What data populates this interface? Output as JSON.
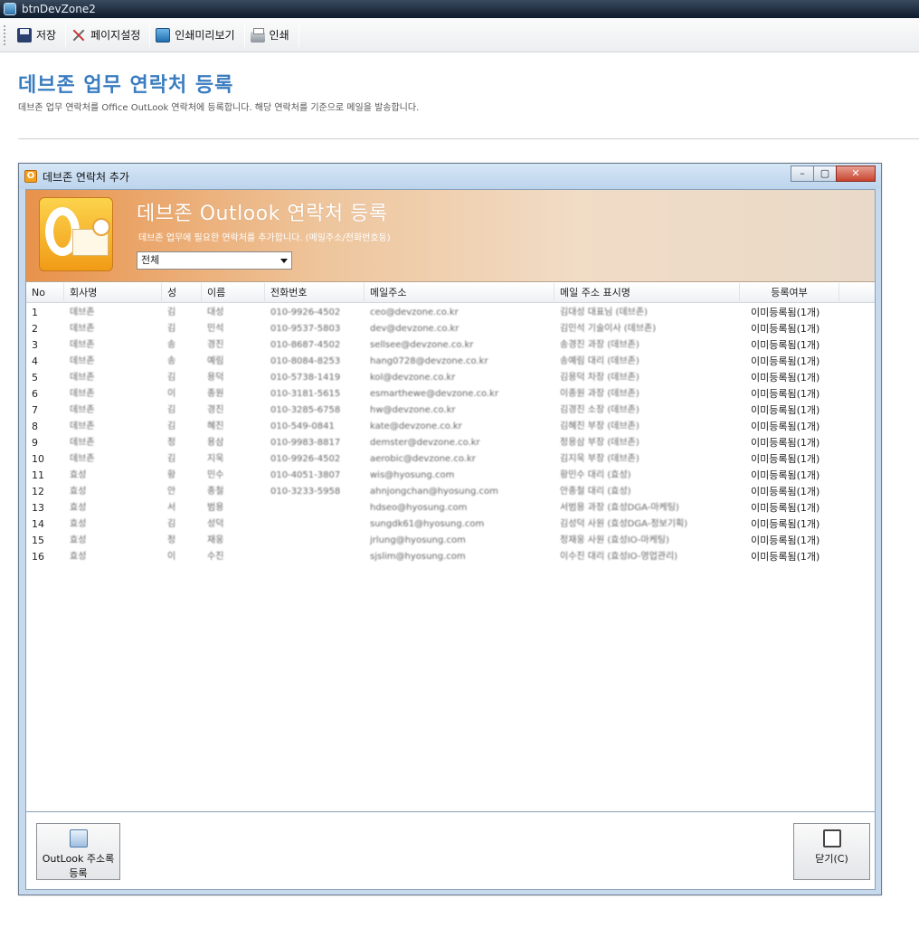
{
  "window": {
    "title": "btnDevZone2"
  },
  "toolbar": {
    "save": "저장",
    "page_setup": "페이지설정",
    "print_preview": "인쇄미리보기",
    "print": "인쇄"
  },
  "page": {
    "title": "데브존 업무 연락처 등록",
    "description": "데브존 업무 연락처를 Office OutLook 연락처에 등록합니다. 해당 연락처를 기준으로 메일을 발송합니다."
  },
  "dialog": {
    "title": "데브존 연락처 추가",
    "controls": {
      "minimize": "–",
      "maximize": "▢",
      "close": "✕"
    },
    "banner_title": "데브존 Outlook 연락처 등록",
    "banner_sub": "데브존 업무에 필요한 연락처를 추가합니다. (메일주소/전화번호등)",
    "filter_value": "전체",
    "columns": [
      "No",
      "회사명",
      "성",
      "이름",
      "전화번호",
      "메일주소",
      "메일 주소 표시명",
      "등록여부"
    ],
    "rows": [
      {
        "no": "1",
        "company": "데브존",
        "last": "김",
        "first": "대성",
        "phone": "010-9926-4502",
        "email": "ceo@devzone.co.kr",
        "display": "김대성 대표님 (데브존)",
        "status": "이미등록됨(1개)"
      },
      {
        "no": "2",
        "company": "데브존",
        "last": "김",
        "first": "민석",
        "phone": "010-9537-5803",
        "email": "dev@devzone.co.kr",
        "display": "김민석 기술이사 (데브존)",
        "status": "이미등록됨(1개)"
      },
      {
        "no": "3",
        "company": "데브존",
        "last": "송",
        "first": "경진",
        "phone": "010-8687-4502",
        "email": "sellsee@devzone.co.kr",
        "display": "송경진 과장 (데브존)",
        "status": "이미등록됨(1개)"
      },
      {
        "no": "4",
        "company": "데브존",
        "last": "송",
        "first": "예림",
        "phone": "010-8084-8253",
        "email": "hang0728@devzone.co.kr",
        "display": "송예림 대리 (데브존)",
        "status": "이미등록됨(1개)"
      },
      {
        "no": "5",
        "company": "데브존",
        "last": "김",
        "first": "용덕",
        "phone": "010-5738-1419",
        "email": "kol@devzone.co.kr",
        "display": "김용덕 차장 (데브존)",
        "status": "이미등록됨(1개)"
      },
      {
        "no": "6",
        "company": "데브존",
        "last": "이",
        "first": "종원",
        "phone": "010-3181-5615",
        "email": "esmarthewe@devzone.co.kr",
        "display": "이종원 과장 (데브존)",
        "status": "이미등록됨(1개)"
      },
      {
        "no": "7",
        "company": "데브존",
        "last": "김",
        "first": "경진",
        "phone": "010-3285-6758",
        "email": "hw@devzone.co.kr",
        "display": "김경진 소장 (데브존)",
        "status": "이미등록됨(1개)"
      },
      {
        "no": "8",
        "company": "데브존",
        "last": "김",
        "first": "혜진",
        "phone": "010-549-0841",
        "email": "kate@devzone.co.kr",
        "display": "김혜진 부장 (데브존)",
        "status": "이미등록됨(1개)"
      },
      {
        "no": "9",
        "company": "데브존",
        "last": "정",
        "first": "용삼",
        "phone": "010-9983-8817",
        "email": "demster@devzone.co.kr",
        "display": "정용삼 부장 (데브존)",
        "status": "이미등록됨(1개)"
      },
      {
        "no": "10",
        "company": "데브존",
        "last": "김",
        "first": "지욱",
        "phone": "010-9926-4502",
        "email": "aerobic@devzone.co.kr",
        "display": "김지욱 부장 (데브존)",
        "status": "이미등록됨(1개)"
      },
      {
        "no": "11",
        "company": "효성",
        "last": "황",
        "first": "민수",
        "phone": "010-4051-3807",
        "email": "wis@hyosung.com",
        "display": "황민수 대리 (효성)",
        "status": "이미등록됨(1개)"
      },
      {
        "no": "12",
        "company": "효성",
        "last": "안",
        "first": "종철",
        "phone": "010-3233-5958",
        "email": "ahnjongchan@hyosung.com",
        "display": "안종철 대리 (효성)",
        "status": "이미등록됨(1개)"
      },
      {
        "no": "13",
        "company": "효성",
        "last": "서",
        "first": "범용",
        "phone": "",
        "email": "hdseo@hyosung.com",
        "display": "서범용 과장 (효성DGA-마케팅)",
        "status": "이미등록됨(1개)"
      },
      {
        "no": "14",
        "company": "효성",
        "last": "김",
        "first": "성덕",
        "phone": "",
        "email": "sungdk61@hyosung.com",
        "display": "김성덕 사원 (효성DGA-정보기획)",
        "status": "이미등록됨(1개)"
      },
      {
        "no": "15",
        "company": "효성",
        "last": "정",
        "first": "재웅",
        "phone": "",
        "email": "jrlung@hyosung.com",
        "display": "정재웅 사원 (효성IO-마케팅)",
        "status": "이미등록됨(1개)"
      },
      {
        "no": "16",
        "company": "효성",
        "last": "이",
        "first": "수진",
        "phone": "",
        "email": "sjslim@hyosung.com",
        "display": "이수진 대리 (효성IO-영업관리)",
        "status": "이미등록됨(1개)"
      }
    ],
    "outlook_button": "OutLook 주소록 등록",
    "close_button": "닫기(C)"
  },
  "colors": {
    "title_blue": "#3a7cc0",
    "banner_orange": "#e8924b"
  }
}
